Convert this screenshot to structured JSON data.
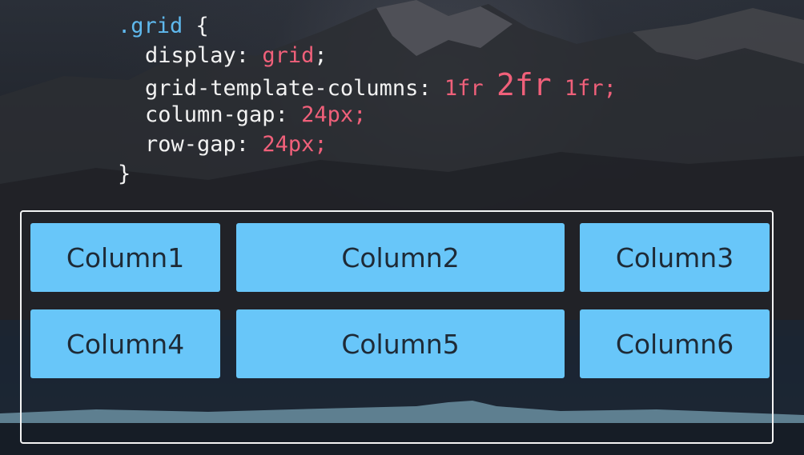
{
  "code": {
    "selector": ".grid",
    "open_brace": "{",
    "close_brace": "}",
    "properties": [
      {
        "name": "display",
        "value": "grid"
      },
      {
        "name": "grid-template-columns",
        "value_parts": [
          "1fr",
          "2fr",
          "1fr"
        ]
      },
      {
        "name": "column-gap",
        "value": "24px"
      },
      {
        "name": "row-gap",
        "value": "24px"
      }
    ]
  },
  "grid": {
    "cells": [
      "Column1",
      "Column2",
      "Column3",
      "Column4",
      "Column5",
      "Column6"
    ]
  },
  "colors": {
    "cell_background": "#68c6f9",
    "cell_text": "#1e2a36",
    "selector": "#5fb9ee",
    "value": "#f0607a",
    "code_text": "#f2f2f2",
    "border": "#f4f4f4"
  }
}
